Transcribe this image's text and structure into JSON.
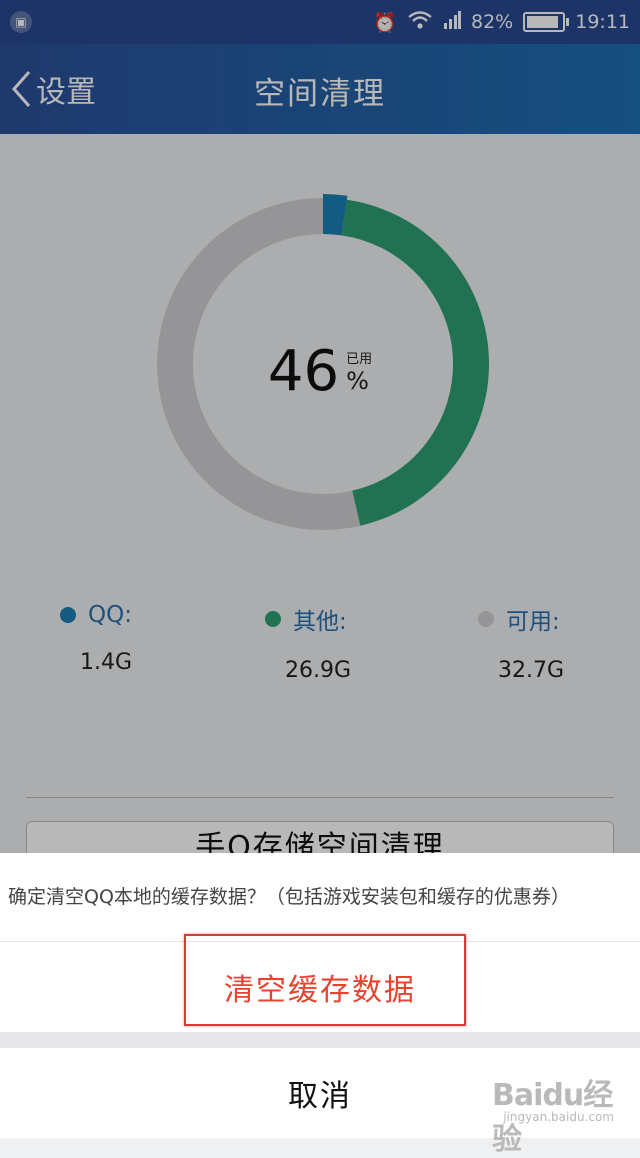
{
  "status_bar": {
    "battery": "82%",
    "time": "19:11"
  },
  "header": {
    "back_label": "设置",
    "title": "空间清理"
  },
  "usage": {
    "percent": "46",
    "used_label": "已用",
    "percent_sign": "%",
    "colors": {
      "qq": "#1b7fb2",
      "other": "#2e9e73",
      "available": "#cfcfd1"
    },
    "legend": [
      {
        "label": "QQ:",
        "value": "1.4G"
      },
      {
        "label": "其他:",
        "value": "26.9G"
      },
      {
        "label": "可用:",
        "value": "32.7G"
      }
    ]
  },
  "storage_button": {
    "label": "手Q存储空间清理"
  },
  "dialog": {
    "message": "确定清空QQ本地的缓存数据？（包括游戏安装包和缓存的优惠券）",
    "confirm_label": "清空缓存数据",
    "cancel_label": "取消",
    "confirm_color": "#e8432f"
  },
  "watermark": {
    "main": "Baidu经验",
    "sub": "jingyan.baidu.com"
  },
  "chart_data": {
    "type": "pie",
    "categories": [
      "QQ",
      "其他",
      "可用"
    ],
    "values": [
      1.4,
      26.9,
      32.7
    ]
  }
}
